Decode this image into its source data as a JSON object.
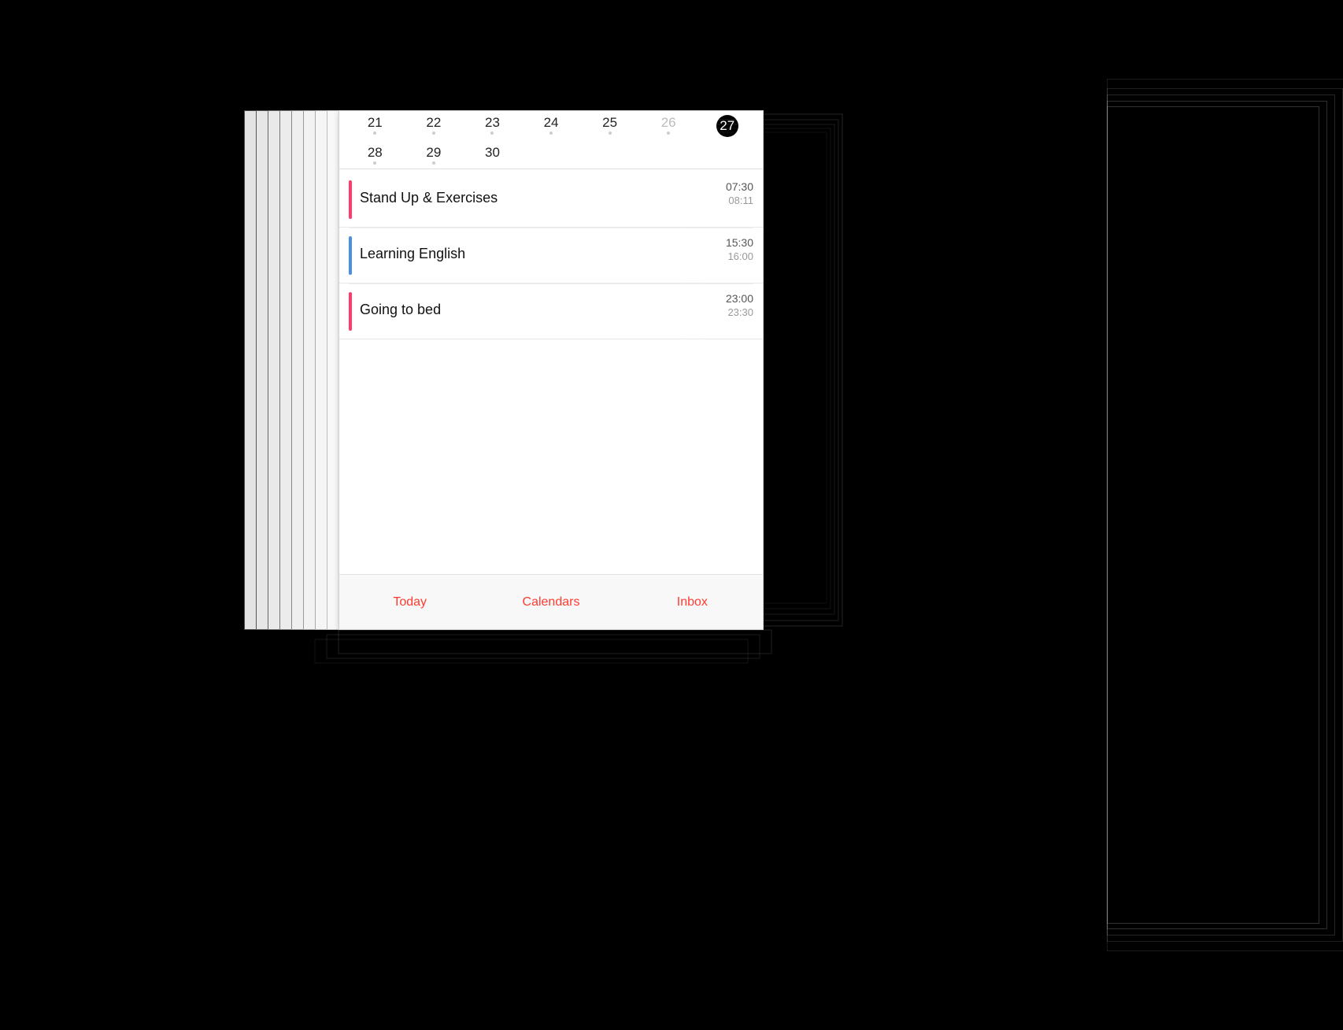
{
  "scene": {
    "background": "#000"
  },
  "calendar": {
    "weeks": [
      {
        "days": [
          {
            "num": "21",
            "grayed": false,
            "dot": true,
            "today": false
          },
          {
            "num": "22",
            "grayed": false,
            "dot": true,
            "today": false
          },
          {
            "num": "23",
            "grayed": false,
            "dot": true,
            "today": false
          },
          {
            "num": "24",
            "grayed": false,
            "dot": true,
            "today": false
          },
          {
            "num": "25",
            "grayed": false,
            "dot": true,
            "today": false
          },
          {
            "num": "26",
            "grayed": true,
            "dot": true,
            "today": false
          },
          {
            "num": "27",
            "grayed": false,
            "dot": false,
            "today": true
          }
        ]
      },
      {
        "days": [
          {
            "num": "28",
            "grayed": false,
            "dot": true,
            "today": false
          },
          {
            "num": "29",
            "grayed": false,
            "dot": true,
            "today": false
          },
          {
            "num": "30",
            "grayed": false,
            "dot": false,
            "today": false
          },
          {
            "num": "",
            "grayed": true,
            "dot": false,
            "today": false
          },
          {
            "num": "",
            "grayed": true,
            "dot": false,
            "today": false
          },
          {
            "num": "",
            "grayed": true,
            "dot": false,
            "today": false
          },
          {
            "num": "",
            "grayed": true,
            "dot": false,
            "today": false
          }
        ]
      }
    ],
    "events": [
      {
        "id": "stand-up",
        "title": "Stand Up & Exercises",
        "color": "#ff3b6e",
        "time_start": "07:30",
        "time_end": "08:11"
      },
      {
        "id": "learning-english",
        "title": "Learning English",
        "color": "#4a90e2",
        "time_start": "15:30",
        "time_end": "16:00"
      },
      {
        "id": "going-to-bed",
        "title": "Going to bed",
        "color": "#ff3b6e",
        "time_start": "23:00",
        "time_end": "23:30"
      }
    ],
    "tabs": [
      {
        "id": "today",
        "label": "Today"
      },
      {
        "id": "calendars",
        "label": "Calendars"
      },
      {
        "id": "inbox",
        "label": "Inbox"
      }
    ]
  }
}
